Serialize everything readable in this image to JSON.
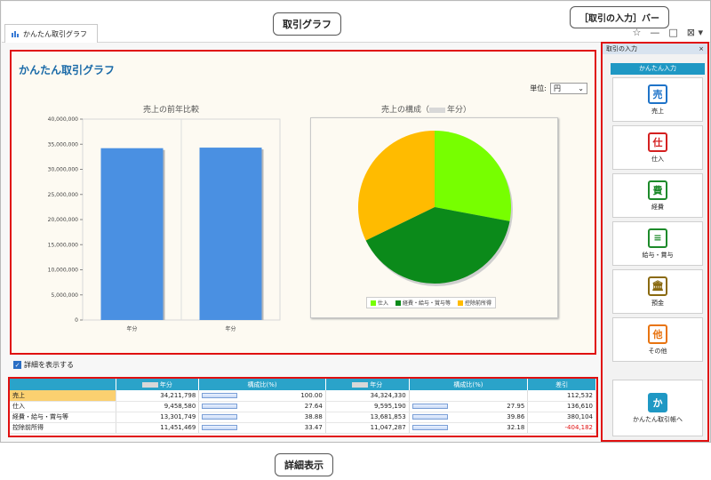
{
  "window": {
    "tab_title": "かんたん取引グラフ",
    "controls": [
      "☆",
      "—",
      "□",
      "⊠ ▾"
    ]
  },
  "callouts": {
    "graph": "取引グラフ",
    "input_bar": "［取引の入力］バー",
    "detail": "詳細表示"
  },
  "graph": {
    "title": "かんたん取引グラフ",
    "unit_label": "単位:",
    "unit_value": "円",
    "bar_title": "売上の前年比較",
    "pie_title_prefix": "売上の構成（",
    "pie_title_suffix": "年分）"
  },
  "chart_data": [
    {
      "type": "bar",
      "title": "売上の前年比較",
      "categories": [
        "年分",
        "年分"
      ],
      "values": [
        34211798,
        34324330
      ],
      "ylim": [
        0,
        40000000
      ],
      "yticks": [
        "40,000,000",
        "35,000,000",
        "30,000,000",
        "25,000,000",
        "20,000,000",
        "15,000,000",
        "10,000,000",
        "5,000,000",
        "0"
      ],
      "color": "#4a90e2",
      "grid": true
    },
    {
      "type": "pie",
      "title": "売上の構成（年分）",
      "labels": [
        "仕入",
        "経費・給与・賞与等",
        "控除前所得"
      ],
      "values": [
        27.95,
        39.86,
        32.18
      ],
      "colors": [
        "#77ff00",
        "#0b8a1a",
        "#ffbb00"
      ],
      "legend": "bottom"
    }
  ],
  "detail": {
    "toggle_label": "詳細を表示する",
    "headers": [
      "年分",
      "構成比(%)",
      "年分",
      "構成比(%)",
      "差引"
    ],
    "rows": [
      {
        "label": "売上",
        "v1": "34,211,798",
        "p1": "100.00",
        "v2": "34,324,330",
        "p2": "",
        "diff": "112,532"
      },
      {
        "label": "仕入",
        "v1": "9,458,580",
        "p1": "27.64",
        "v2": "9,595,190",
        "p2": "27.95",
        "diff": "136,610"
      },
      {
        "label": "経費・給与・賞与等",
        "v1": "13,301,749",
        "p1": "38.88",
        "v2": "13,681,853",
        "p2": "39.86",
        "diff": "380,104"
      },
      {
        "label": "控除前所得",
        "v1": "11,451,469",
        "p1": "33.47",
        "v2": "11,047,287",
        "p2": "32.18",
        "diff": "-404,182"
      }
    ]
  },
  "side": {
    "header": "取引の入力",
    "close": "×",
    "quick_button": "かんたん入力",
    "items": [
      {
        "label": "売上",
        "glyph": "売",
        "color": "#1e73c8"
      },
      {
        "label": "仕入",
        "glyph": "仕",
        "color": "#d42020"
      },
      {
        "label": "経費",
        "glyph": "費",
        "color": "#1d8a2a"
      },
      {
        "label": "給与・賞与",
        "glyph": "≡",
        "color": "#1d8a2a"
      },
      {
        "label": "預金",
        "glyph": "🏛",
        "color": "#8a6a10"
      },
      {
        "label": "その他",
        "glyph": "他",
        "color": "#e87410"
      }
    ],
    "bottom_button": {
      "label": "かんたん取引帳へ",
      "glyph": "か",
      "color": "#1f98c4"
    }
  }
}
